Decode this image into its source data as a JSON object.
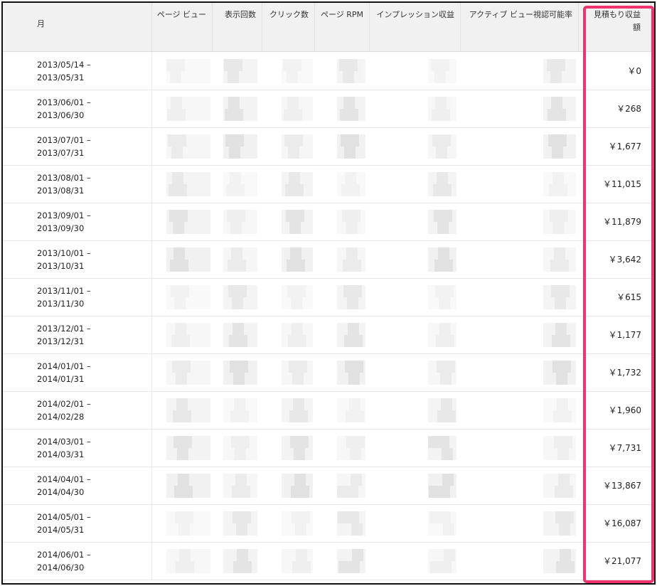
{
  "table": {
    "headers": [
      {
        "key": "month",
        "label": "月"
      },
      {
        "key": "pageviews",
        "label": "ページ ビュー"
      },
      {
        "key": "impressions",
        "label": "表示回数"
      },
      {
        "key": "clicks",
        "label": "クリック数"
      },
      {
        "key": "page_rpm",
        "label": "ページ RPM"
      },
      {
        "key": "impression_revenue",
        "label": "インプレッション収益"
      },
      {
        "key": "active_view",
        "label": "アクティブ ビュー視認可能率"
      },
      {
        "key": "estimated_earnings",
        "label": "見積もり収益額"
      }
    ],
    "rows": [
      {
        "start": "2013/05/14 –",
        "end": "2013/05/31",
        "earnings": "￥0"
      },
      {
        "start": "2013/06/01 –",
        "end": "2013/06/30",
        "earnings": "￥268"
      },
      {
        "start": "2013/07/01 –",
        "end": "2013/07/31",
        "earnings": "￥1,677"
      },
      {
        "start": "2013/08/01 –",
        "end": "2013/08/31",
        "earnings": "￥11,015"
      },
      {
        "start": "2013/09/01 –",
        "end": "2013/09/30",
        "earnings": "￥11,879"
      },
      {
        "start": "2013/10/01 –",
        "end": "2013/10/31",
        "earnings": "￥3,642"
      },
      {
        "start": "2013/11/01 –",
        "end": "2013/11/30",
        "earnings": "￥615"
      },
      {
        "start": "2013/12/01 –",
        "end": "2013/12/31",
        "earnings": "￥1,177"
      },
      {
        "start": "2014/01/01 –",
        "end": "2014/01/31",
        "earnings": "￥1,732"
      },
      {
        "start": "2014/02/01 –",
        "end": "2014/02/28",
        "earnings": "￥1,960"
      },
      {
        "start": "2014/03/01 –",
        "end": "2014/03/31",
        "earnings": "￥7,731"
      },
      {
        "start": "2014/04/01 –",
        "end": "2014/04/30",
        "earnings": "￥13,867"
      },
      {
        "start": "2014/05/01 –",
        "end": "2014/05/31",
        "earnings": "￥16,087"
      },
      {
        "start": "2014/06/01 –",
        "end": "2014/06/30",
        "earnings": "￥21,077"
      }
    ]
  },
  "colors": {
    "highlight": "#f0336e",
    "header_bg": "#f1f1f1",
    "pixelated": "#dcdcdc"
  }
}
